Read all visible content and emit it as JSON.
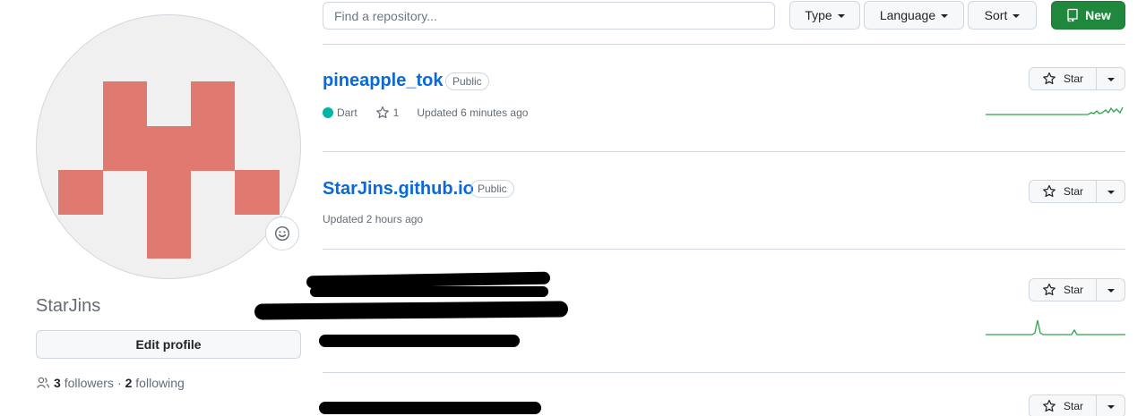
{
  "profile": {
    "username": "StarJins",
    "edit_label": "Edit profile",
    "followers_count": "3",
    "followers_label": "followers",
    "separator": "·",
    "following_count": "2",
    "following_label": "following",
    "avatar_color": "#e07a70"
  },
  "toolbar": {
    "search_placeholder": "Find a repository...",
    "type_label": "Type",
    "language_label": "Language",
    "sort_label": "Sort",
    "new_label": "New"
  },
  "repos": [
    {
      "name": "pineapple_tok",
      "visibility": "Public",
      "language": "Dart",
      "language_color": "#00b4ab",
      "stars": "1",
      "updated": "Updated 6 minutes ago",
      "star_label": "Star"
    },
    {
      "name": "StarJins.github.io",
      "visibility": "Public",
      "updated": "Updated 2 hours ago",
      "star_label": "Star"
    },
    {
      "star_label": "Star"
    },
    {
      "star_label": "Star"
    }
  ],
  "colors": {
    "accent": "#0969da",
    "primary_button": "#1f883d",
    "sparkline": "#2da44e"
  }
}
